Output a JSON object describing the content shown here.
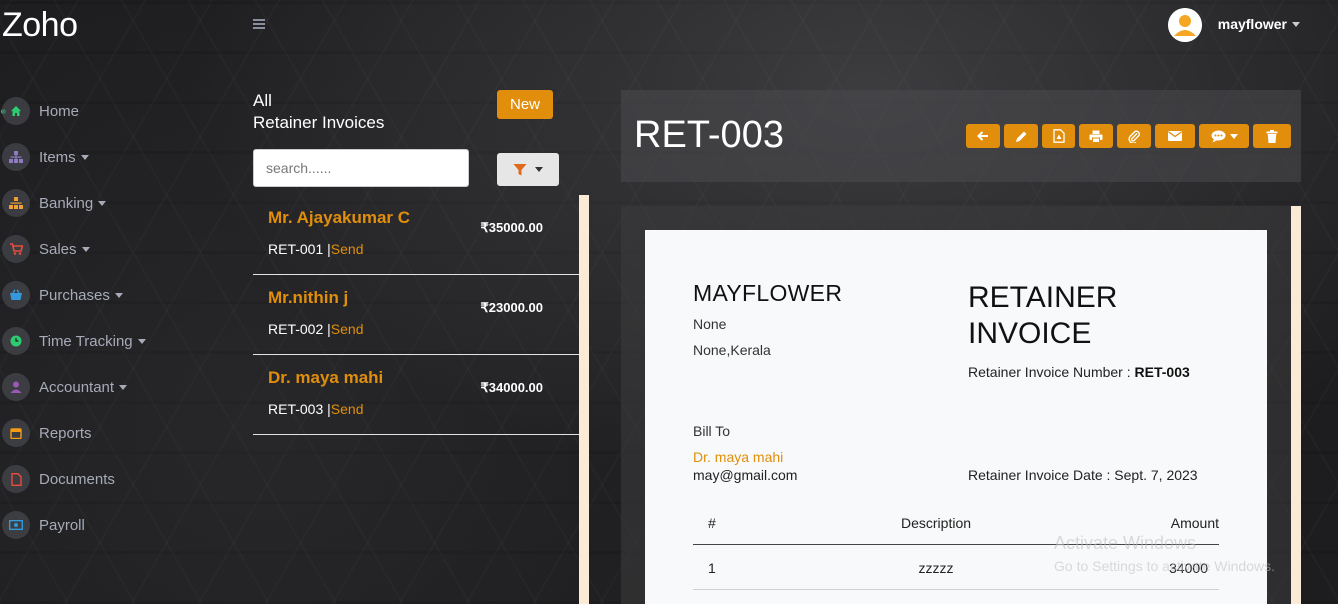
{
  "app": {
    "brand": "Zoho"
  },
  "header": {
    "username": "mayflower"
  },
  "sidebar": {
    "items": [
      {
        "label": "Home",
        "icon": "home-icon",
        "color": "#2ecc71"
      },
      {
        "label": "Items",
        "icon": "sitemap-icon",
        "color": "#8e7cc3"
      },
      {
        "label": "Banking",
        "icon": "bank-icon",
        "color": "#f0a030"
      },
      {
        "label": "Sales",
        "icon": "cart-icon",
        "color": "#e74c3c"
      },
      {
        "label": "Purchases",
        "icon": "basket-icon",
        "color": "#3498db"
      },
      {
        "label": "Time Tracking",
        "icon": "clock-icon",
        "color": "#2ecc71"
      },
      {
        "label": "Accountant",
        "icon": "user-icon",
        "color": "#9b59b6"
      },
      {
        "label": "Reports",
        "icon": "calendar-icon",
        "color": "#f39c12"
      },
      {
        "label": "Documents",
        "icon": "document-icon",
        "color": "#e74c3c"
      },
      {
        "label": "Payroll",
        "icon": "money-icon",
        "color": "#3498db"
      }
    ]
  },
  "list": {
    "title_line1": "All",
    "title_line2": "Retainer Invoices",
    "new_label": "New",
    "search_placeholder": "search......",
    "sep": " |",
    "items": [
      {
        "name": "Mr. Ajayakumar C",
        "number": "RET-001",
        "action": "Send",
        "amount": "₹35000.00"
      },
      {
        "name": "Mr.nithin j",
        "number": "RET-002",
        "action": "Send",
        "amount": "₹23000.00"
      },
      {
        "name": "Dr. maya mahi",
        "number": "RET-003",
        "action": "Send",
        "amount": "₹34000.00"
      }
    ]
  },
  "detail": {
    "title": "RET-003",
    "document": {
      "company": "MAYFLOWER",
      "address_line1": "None",
      "address_line2": "None,Kerala",
      "heading_line1": "RETAINER",
      "heading_line2": "INVOICE",
      "number_label": "Retainer Invoice Number : ",
      "number_value": "RET-003",
      "bill_to_label": "Bill To",
      "bill_to_name": "Dr. maya mahi",
      "bill_to_email": "may@gmail.com",
      "date_text": "Retainer Invoice Date : Sept. 7, 2023",
      "table": {
        "headers": [
          "#",
          "Description",
          "Amount"
        ],
        "rows": [
          [
            "1",
            "zzzzz",
            "34000"
          ]
        ]
      }
    }
  },
  "watermark": {
    "line1": "Activate Windows",
    "line2": "Go to Settings to activate Windows."
  },
  "colors": {
    "accent": "#e08e0b",
    "scrollbar": "#fbebd6"
  }
}
